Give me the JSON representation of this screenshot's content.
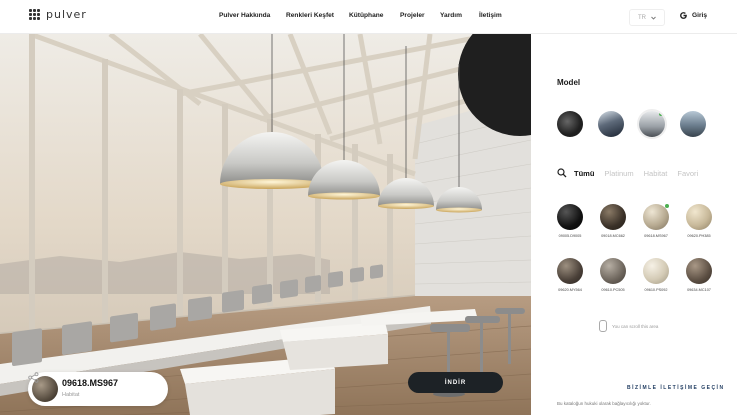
{
  "header": {
    "logo_text": "pulver",
    "nav": [
      "Pulver Hakkında",
      "Renkleri Keşfet",
      "Kütüphane",
      "Projeler",
      "Yardım",
      "İletişim"
    ],
    "language": "TR",
    "login_label": "Giriş"
  },
  "viewer": {
    "product_code": "09618.MS967",
    "product_collection": "Habitat",
    "download_label": "İNDİR"
  },
  "panel": {
    "title": "Model",
    "models": [
      {
        "icon": "model-sphere",
        "selected": false
      },
      {
        "icon": "model-building",
        "selected": false
      },
      {
        "icon": "model-interior",
        "selected": true
      },
      {
        "icon": "model-terrace",
        "selected": false
      }
    ],
    "tabs": [
      "Tümü",
      "Platinum",
      "Habitat",
      "Favori"
    ],
    "active_tab": "Tümü",
    "swatches": [
      {
        "code": "09005.D9005",
        "color": "#111111"
      },
      {
        "code": "09018.MC662",
        "color": "#3a3128"
      },
      {
        "code": "09618.MS967",
        "color": "#b8ab92",
        "selected": true
      },
      {
        "code": "09620.PH385",
        "color": "#c8b99a"
      },
      {
        "code": "09620.MY564",
        "color": "#4a4038"
      },
      {
        "code": "09610.PC505",
        "color": "#6d655c"
      },
      {
        "code": "09610.PS092",
        "color": "#d4cbb6"
      },
      {
        "code": "09634.MC107",
        "color": "#5c4f43"
      }
    ],
    "scroll_hint": "You can scroll this area",
    "contact_label": "BİZİMLE İLETİŞİME GEÇİN",
    "legal_text": "Bu kataloğun hukuki olarak bağlayıcılığı yoktur."
  },
  "colors": {
    "accent": "#1e3a5f",
    "selected_dot": "#4caf50",
    "button_dark": "#1d2226"
  }
}
